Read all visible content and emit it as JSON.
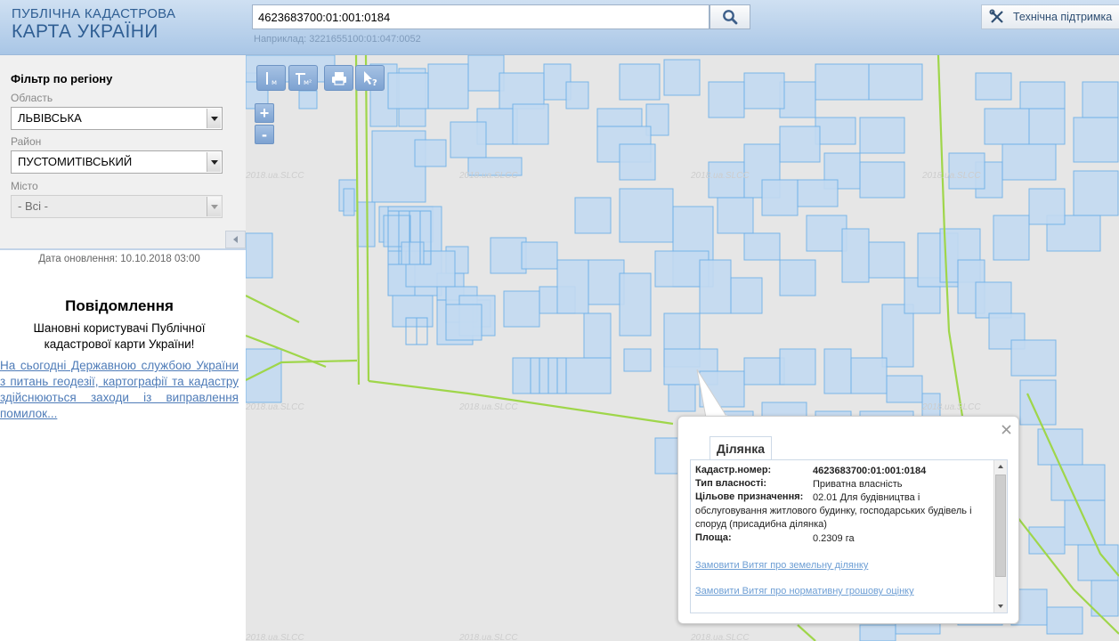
{
  "header": {
    "logo_line1": "ПУБЛІЧНА КАДАСТРОВА",
    "logo_line2": "КАРТА УКРАЇНИ",
    "search_value": "4623683700:01:001:0184",
    "search_hint": "Наприклад: 3221655100:01:047:0052",
    "support_label": "Технічна підтримка"
  },
  "sidebar": {
    "filter_title": "Фільтр по регіону",
    "oblast_label": "Область",
    "oblast_value": "ЛЬВІВСЬКА",
    "raion_label": "Район",
    "raion_value": "ПУСТОМИТІВСЬКИЙ",
    "misto_label": "Місто",
    "misto_value": "- Всі -",
    "update_date": "Дата оновлення: 10.10.2018 03:00",
    "message_title": "Повідомлення",
    "message_text": "Шановні користувачі Публічної кадастрової карти України!",
    "message_link": "На сьогодні Державною службою України з питань геодезії, картографії та кадастру здійснюються заходи із виправлення помилок..."
  },
  "map": {
    "watermark": "2018.ua.SLCC",
    "zoom_in": "+",
    "zoom_out": "-",
    "colors": {
      "parcel_fill": "#c3daf2",
      "parcel_stroke": "#6fb0e8",
      "boundary": "#9fd64a"
    }
  },
  "popup": {
    "tab_label": "Ділянка",
    "cadastral_label": "Кадастр.номер:",
    "cadastral_value": "4623683700:01:001:0184",
    "ownership_label": "Тип власності:",
    "ownership_value": "Приватна власність",
    "purpose_label": "Цільове призначення:",
    "purpose_line1": "02.01 Для будівництва і",
    "purpose_line2": "обслуговування житлового будинку, господарських будівель і",
    "purpose_line3": "споруд (присадибна ділянка)",
    "area_label": "Площа:",
    "area_value": "0.2309 га",
    "link_extract": "Замовити Витяг про земельну ділянку",
    "link_valuation": "Замовити Витяг про нормативну грошову оцінку"
  }
}
